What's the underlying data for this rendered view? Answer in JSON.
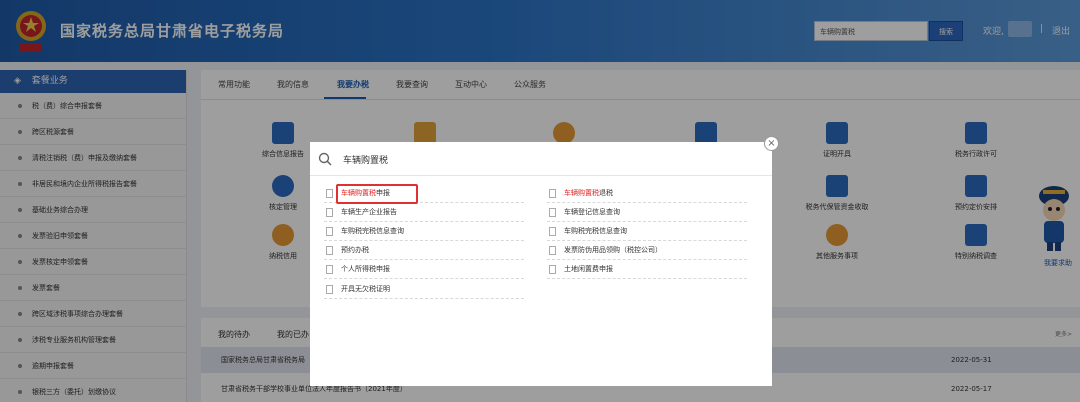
{
  "header": {
    "title": "国家税务总局甘肃省电子税务局",
    "search_value": "车辆购置税",
    "search_button": "搜索",
    "welcome": "欢迎,",
    "separator": "|",
    "logout": "退出"
  },
  "sidebar": {
    "heading": "套餐业务",
    "items": [
      "税（费）综合申报套餐",
      "跨区税源套餐",
      "清税注销税（费）申报及缴纳套餐",
      "非居民和境内企业所得税报告套餐",
      "基础业务综合办理",
      "发票验旧申领套餐",
      "发票核定申领套餐",
      "发票套餐",
      "跨区域涉税事项综合办理套餐",
      "涉税专业服务机构管理套餐",
      "逾期申报套餐",
      "银税三方（委托）划缴协议"
    ]
  },
  "tabs": [
    "常用功能",
    "我的信息",
    "我要办税",
    "我要查询",
    "互动中心",
    "公众服务"
  ],
  "grid": {
    "comprehensive_report": "综合信息报告",
    "certificate_issue": "证明开具",
    "admin_license": "税务行政许可",
    "verification_mgmt": "核定管理",
    "deposit_receipt": "税务代保管资金收取",
    "fixed_schedule": "预约定价安排",
    "credit": "纳税信用",
    "other_services": "其他服务事项",
    "special_survey": "特别纳税调查"
  },
  "robot_label": "我要求助",
  "lower": {
    "tab1": "我的待办",
    "tab2": "我的已办",
    "more": "更多>",
    "rows": [
      {
        "text": "国家税务总局甘肃省税务局",
        "date": "2022-05-31"
      },
      {
        "text": "甘肃省税务干部学校事业单位法人年度报告书（2021年度）",
        "date": "2022-05-17"
      }
    ]
  },
  "modal": {
    "query": "车辆购置税",
    "results_left": [
      {
        "pre": "",
        "hl": "车辆购置税",
        "post": "申报"
      },
      {
        "pre": "车辆生产企业报告",
        "hl": "",
        "post": ""
      },
      {
        "pre": "车购税完税信息查询",
        "hl": "",
        "post": ""
      },
      {
        "pre": "预约办税",
        "hl": "",
        "post": ""
      },
      {
        "pre": "个人所得税申报",
        "hl": "",
        "post": ""
      },
      {
        "pre": "开具无欠税证明",
        "hl": "",
        "post": ""
      }
    ],
    "results_right": [
      {
        "pre": "",
        "hl": "车辆购置税",
        "post": "退税"
      },
      {
        "pre": "车辆登记信息查询",
        "hl": "",
        "post": ""
      },
      {
        "pre": "车购税完税信息查询",
        "hl": "",
        "post": ""
      },
      {
        "pre": "发票防伪用品领购（税控公司）",
        "hl": "",
        "post": ""
      },
      {
        "pre": "土地闲置费申报",
        "hl": "",
        "post": ""
      }
    ],
    "close_label": "×"
  }
}
